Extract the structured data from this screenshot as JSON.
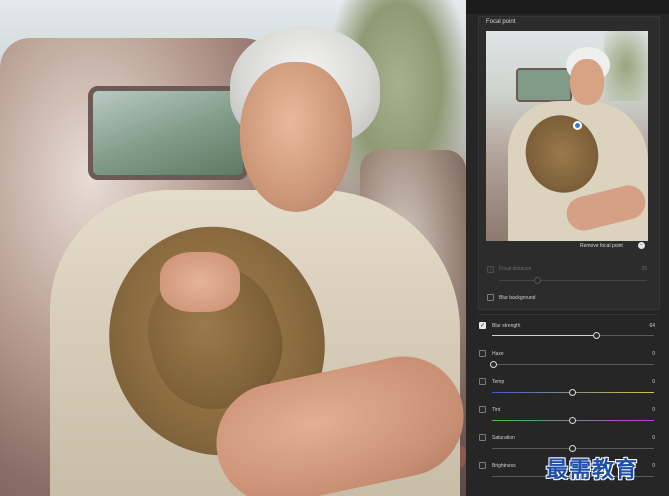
{
  "focal_point": {
    "title": "Focal point",
    "remove_label": "Remove focal point",
    "remove_icon": "minus-circle-icon",
    "focal_distance": {
      "label": "Focal distance",
      "value": "25",
      "fraction": 0.25,
      "enabled": false
    },
    "blur_background": {
      "label": "Blur background",
      "checked": false
    }
  },
  "adjustments": [
    {
      "id": "blur-strength",
      "label": "Blur strength",
      "value": "64",
      "checked": true,
      "slider": "neutral",
      "fraction": 0.64
    },
    {
      "id": "haze",
      "label": "Haze",
      "value": "0",
      "checked": false,
      "slider": "neutral",
      "fraction": 0.0
    },
    {
      "id": "temp",
      "label": "Temp",
      "value": "0",
      "checked": false,
      "slider": "temp",
      "fraction": 0.5
    },
    {
      "id": "tint",
      "label": "Tint",
      "value": "0",
      "checked": false,
      "slider": "tint",
      "fraction": 0.5
    },
    {
      "id": "saturation",
      "label": "Saturation",
      "value": "0",
      "checked": false,
      "slider": "neutral",
      "fraction": 0.5
    },
    {
      "id": "brightness",
      "label": "Brightness",
      "value": "0",
      "checked": false,
      "slider": "neutral",
      "fraction": 0.5
    }
  ],
  "colors": {
    "temp_gradient": [
      "#3b5bd6",
      "#d6c23b"
    ],
    "tint_gradient": [
      "#3bc24a",
      "#c23bd6"
    ],
    "focal_dot": "#2d7be5"
  },
  "watermark": {
    "text": "最需教育"
  }
}
